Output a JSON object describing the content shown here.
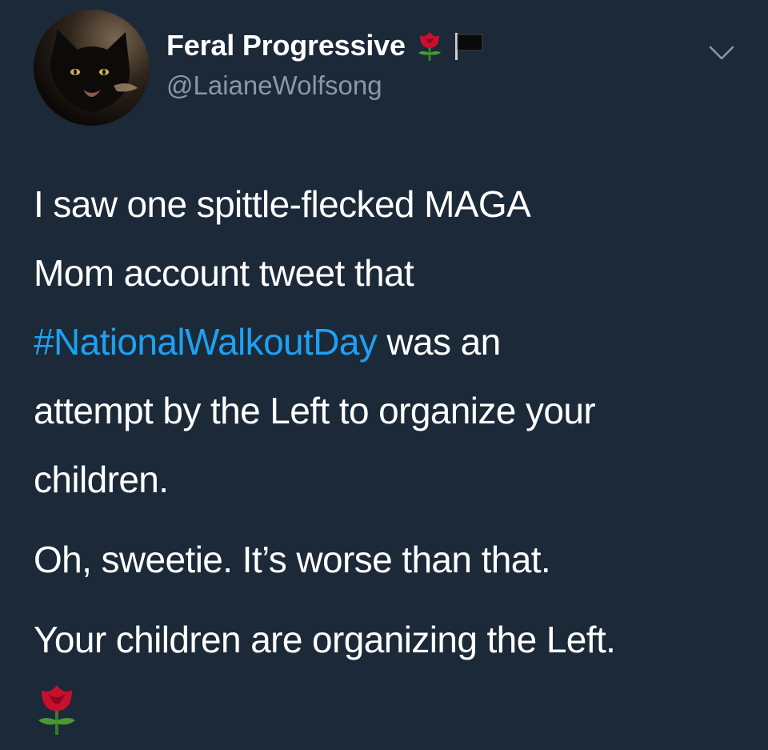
{
  "header": {
    "display_name": "Feral Progressive",
    "handle": "@LaianeWolfsong",
    "name_emojis": [
      "rose-icon",
      "black-flag-icon"
    ]
  },
  "tweet": {
    "line1_pre": "I saw one spittle-flecked MAGA",
    "line2": "Mom account tweet that",
    "hashtag": "#NationalWalkoutDay",
    "line3_post": " was an",
    "line4": "attempt by the Left to organize your",
    "line5": "children.",
    "para2": "Oh, sweetie. It’s worse than that.",
    "para3": "Your children are organizing the Left.",
    "end_emoji": "rose-icon"
  },
  "colors": {
    "background": "#1c2938",
    "text": "#ffffff",
    "secondary_text": "#8899a6",
    "link": "#1da1f2"
  }
}
